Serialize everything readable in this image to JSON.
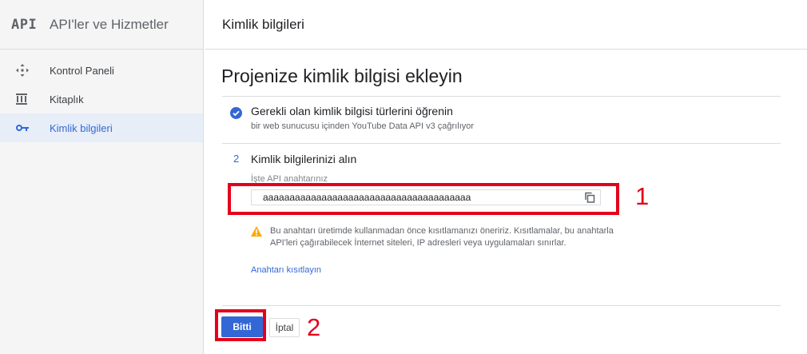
{
  "sidebar": {
    "logo": "API",
    "title": "API'ler ve Hizmetler",
    "items": [
      {
        "label": "Kontrol Paneli",
        "icon": "dashboard-icon"
      },
      {
        "label": "Kitaplık",
        "icon": "library-icon"
      },
      {
        "label": "Kimlik bilgileri",
        "icon": "key-icon",
        "active": true
      }
    ]
  },
  "header": {
    "title": "Kimlik bilgileri"
  },
  "main": {
    "page_title": "Projenize kimlik bilgisi ekleyin",
    "step1": {
      "title": "Gerekli olan kimlik bilgisi türlerini öğrenin",
      "subtitle": "bir web sunucusu içinden YouTube Data API v3 çağrılıyor"
    },
    "step2": {
      "number": "2",
      "title": "Kimlik bilgilerinizi alın",
      "key_label": "İşte API anahtarınız",
      "api_key": "aaaaaaaaaaaaaaaaaaaaaaaaaaaaaaaaaaaaaaa",
      "warning": "Bu anahtarı üretimde kullanmadan önce kısıtlamanızı öneririz. Kısıtlamalar, bu anahtarla API'leri çağırabilecek İnternet siteleri, IP adresleri veya uygulamaları sınırlar.",
      "restrict_link": "Anahtarı kısıtlayın"
    },
    "buttons": {
      "done": "Bitti",
      "cancel": "İptal"
    }
  },
  "annotations": {
    "label1": "1",
    "label2": "2"
  },
  "colors": {
    "accent": "#3367d6",
    "annotation": "#e4001b",
    "warning": "#f9ab00"
  }
}
